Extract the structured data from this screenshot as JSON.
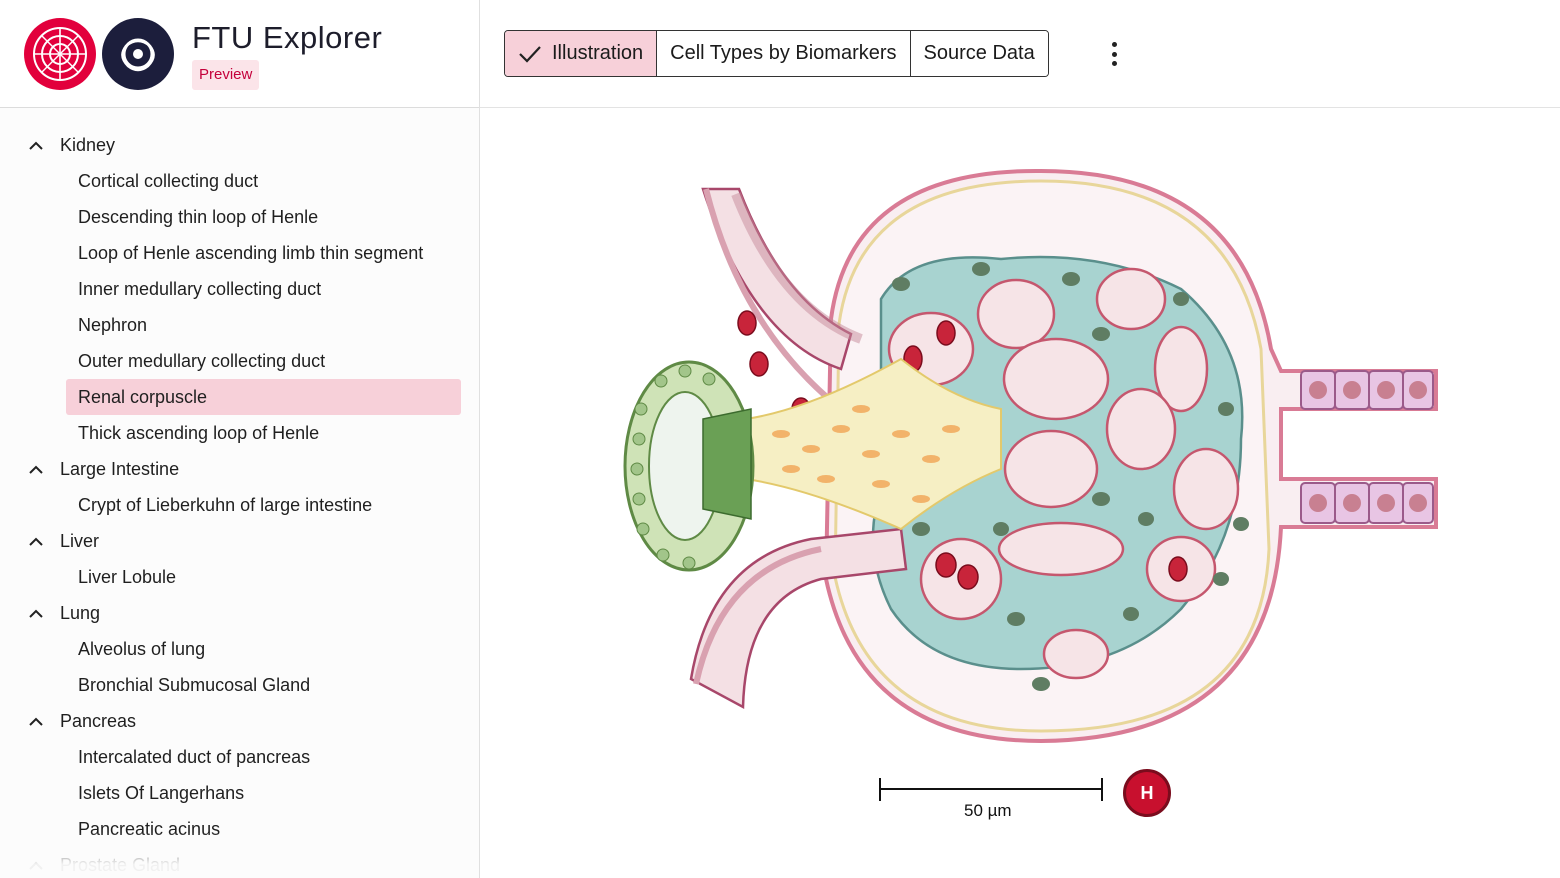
{
  "app": {
    "title": "FTU Explorer",
    "badge": "Preview"
  },
  "toolbar": {
    "tabs": [
      {
        "label": "Illustration",
        "active": true
      },
      {
        "label": "Cell Types by Biomarkers",
        "active": false
      },
      {
        "label": "Source Data",
        "active": false
      }
    ],
    "more_icon": "more-vert-icon"
  },
  "sidebar": {
    "groups": [
      {
        "label": "Kidney",
        "expanded": true,
        "items": [
          "Cortical collecting duct",
          "Descending thin loop of Henle",
          "Loop of Henle ascending limb thin segment",
          "Inner medullary collecting duct",
          "Nephron",
          "Outer medullary collecting duct",
          "Renal corpuscle",
          "Thick ascending loop of Henle"
        ]
      },
      {
        "label": "Large Intestine",
        "expanded": true,
        "items": [
          "Crypt of Lieberkuhn of large intestine"
        ]
      },
      {
        "label": "Liver",
        "expanded": true,
        "items": [
          "Liver Lobule"
        ]
      },
      {
        "label": "Lung",
        "expanded": true,
        "items": [
          "Alveolus of lung",
          "Bronchial Submucosal Gland"
        ]
      },
      {
        "label": "Pancreas",
        "expanded": true,
        "items": [
          "Intercalated duct of pancreas",
          "Islets Of Langerhans",
          "Pancreatic acinus"
        ]
      },
      {
        "label": "Prostate Gland",
        "expanded": true,
        "items": []
      }
    ],
    "selected_item": "Renal corpuscle"
  },
  "illustration": {
    "scale_bar_label": "50 µm",
    "badge_letter": "H"
  },
  "colors": {
    "accent": "#e2003c",
    "selected_bg": "#f7d0d9",
    "navy": "#1c1e3c"
  }
}
